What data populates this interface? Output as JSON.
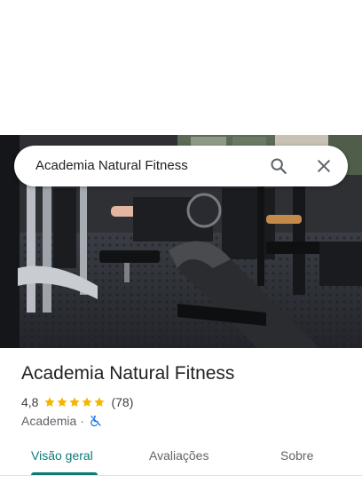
{
  "search": {
    "query": "Academia Natural Fitness",
    "search_icon": "search-icon",
    "close_icon": "close-icon"
  },
  "place": {
    "name": "Academia Natural Fitness",
    "rating": "4,8",
    "stars": 5,
    "review_count": "(78)",
    "category": "Academia",
    "separator": "·",
    "accessibility_icon": "not-wheelchair-accessible-icon"
  },
  "tabs": [
    {
      "label": "Visão geral",
      "selected": true
    },
    {
      "label": "Avaliações",
      "selected": false
    },
    {
      "label": "Sobre",
      "selected": false
    }
  ],
  "colors": {
    "accent": "#0b7a78",
    "star": "#f4b400",
    "access_icon": "#1a73e8"
  }
}
